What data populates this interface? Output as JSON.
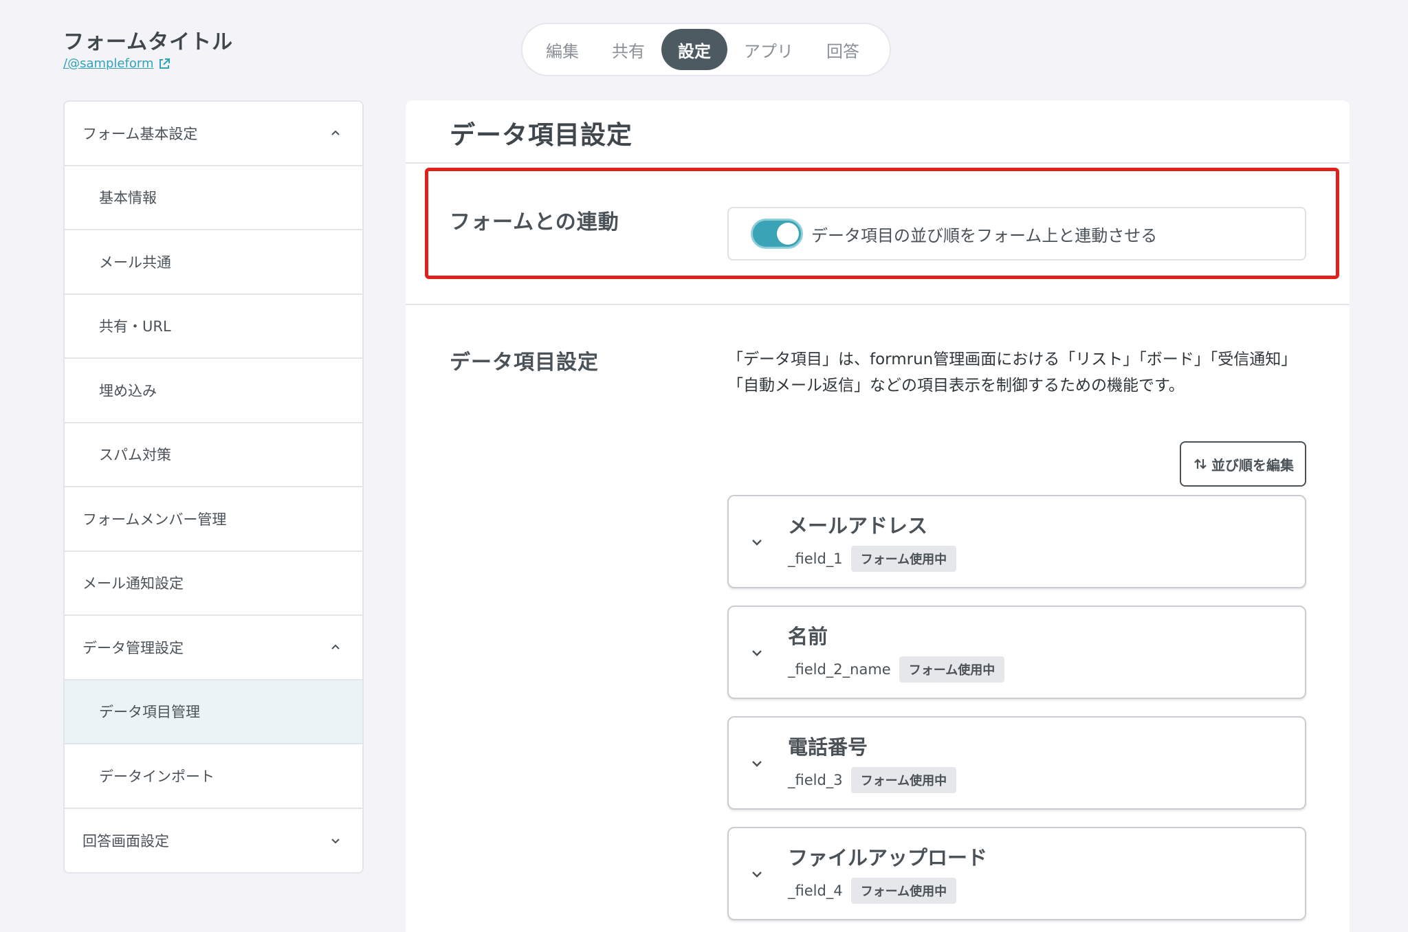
{
  "header": {
    "form_title": "フォームタイトル",
    "form_link": "/@sampleform"
  },
  "tabs": [
    {
      "label": "編集"
    },
    {
      "label": "共有"
    },
    {
      "label": "設定",
      "active": true
    },
    {
      "label": "アプリ"
    },
    {
      "label": "回答"
    }
  ],
  "sidebar": {
    "items": [
      {
        "label": "フォーム基本設定",
        "chevron": "up"
      },
      {
        "label": "基本情報"
      },
      {
        "label": "メール共通"
      },
      {
        "label": "共有・URL"
      },
      {
        "label": "埋め込み"
      },
      {
        "label": "スパム対策"
      },
      {
        "label": "フォームメンバー管理"
      },
      {
        "label": "メール通知設定"
      },
      {
        "label": "データ管理設定",
        "chevron": "up"
      },
      {
        "label": "データ項目管理",
        "selected": true
      },
      {
        "label": "データインポート"
      },
      {
        "label": "回答画面設定",
        "chevron": "down"
      }
    ]
  },
  "main": {
    "title": "データ項目設定",
    "link_section": {
      "label": "フォームとの連動",
      "toggle_label": "データ項目の並び順をフォーム上と連動させる",
      "toggle_on": true
    },
    "data_section": {
      "label": "データ項目設定",
      "description": "「データ項目」は、formrun管理画面における「リスト」「ボード」「受信通知」「自動メール返信」などの項目表示を制御するための機能です。",
      "reorder_button": "並び順を編集"
    },
    "fields": [
      {
        "name": "メールアドレス",
        "key": "_field_1",
        "badge": "フォーム使用中"
      },
      {
        "name": "名前",
        "key": "_field_2_name",
        "badge": "フォーム使用中"
      },
      {
        "name": "電話番号",
        "key": "_field_3",
        "badge": "フォーム使用中"
      },
      {
        "name": "ファイルアップロード",
        "key": "_field_4",
        "badge": "フォーム使用中"
      }
    ]
  },
  "colors": {
    "accent": "#3aa3b5",
    "highlight": "#e0201b",
    "active_tab": "#4d5a62",
    "selected_item": "#eaf4f7"
  }
}
